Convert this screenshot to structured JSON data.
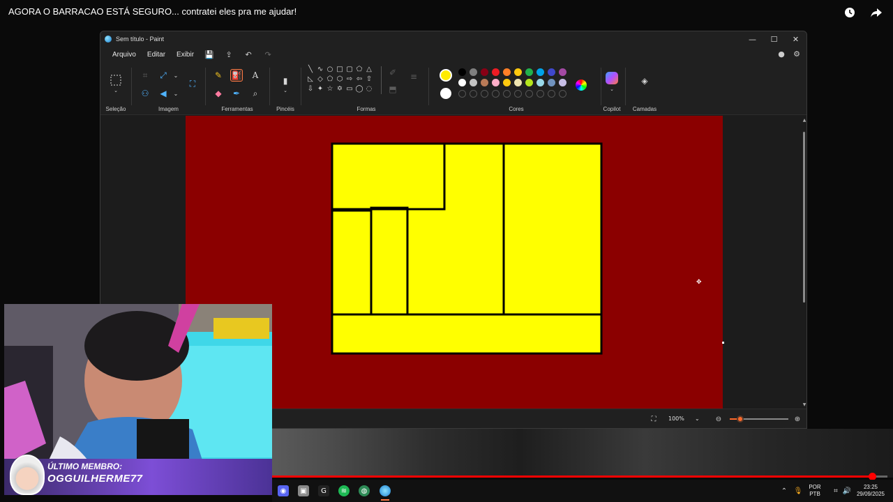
{
  "video": {
    "title": "AGORA O BARRACAO ESTÁ SEGURO... contratei eles pra me ajudar!",
    "icons": [
      "clock-icon",
      "share-icon"
    ]
  },
  "paint": {
    "window_title": "Sem título - Paint",
    "menu": [
      "Arquivo",
      "Editar",
      "Exibir"
    ],
    "ribbon_groups": {
      "selection": "Seleção",
      "image": "Imagem",
      "tools": "Ferramentas",
      "brushes": "Pincéis",
      "shapes": "Formas",
      "colors": "Cores",
      "copilot": "Copilot",
      "layers": "Camadas"
    },
    "colors": {
      "primary": "#ffeb00",
      "secondary": "#ffffff",
      "row1": [
        "#000000",
        "#7f7f7f",
        "#880015",
        "#ed1c24",
        "#ff7f27",
        "#ffc90e",
        "#22b14c",
        "#00a2e8",
        "#3f48cc",
        "#a349a4"
      ],
      "row2": [
        "#ffffff",
        "#c3c3c3",
        "#b97a57",
        "#ffaec9",
        "#ffc90e",
        "#efe4b0",
        "#b5e61d",
        "#99d9ea",
        "#7092be",
        "#c8bfe7"
      ]
    },
    "canvas_bg": "#8b0000",
    "fill_color": "#ffff00",
    "zoom_label": "100%",
    "zoom_fraction": 0.18
  },
  "progress": {
    "fraction": 0.975
  },
  "taskbar": {
    "lang_line1": "POR",
    "lang_line2": "PTB",
    "time": "23:25",
    "date": "29/09/2025"
  },
  "webcam": {
    "badge_label": "ÚLTIMO MEMBRO:",
    "badge_name": "OGGUILHERME77"
  }
}
